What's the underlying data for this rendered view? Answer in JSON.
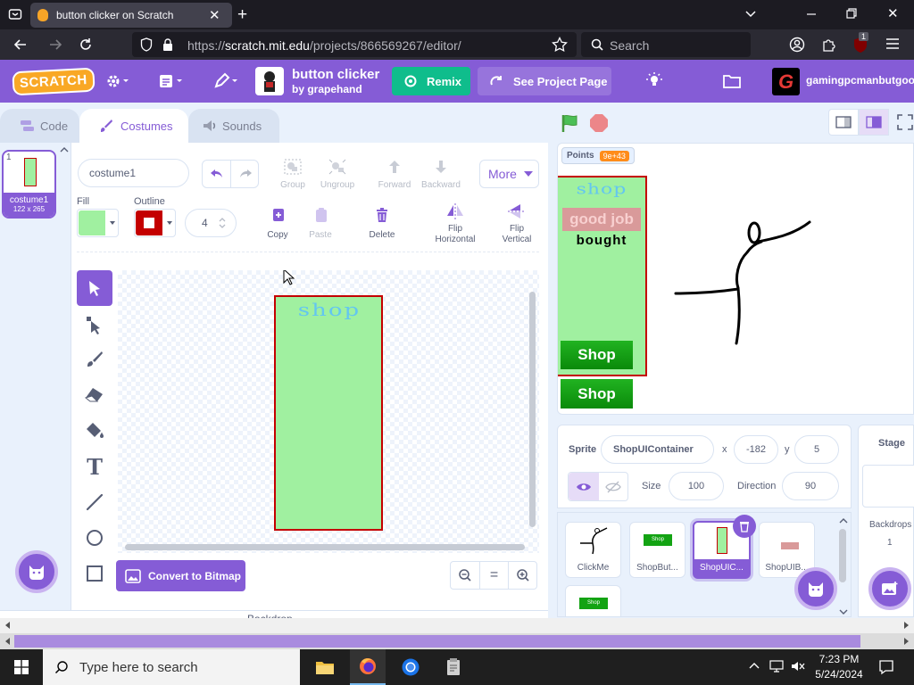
{
  "browser": {
    "tab_title": "button clicker on Scratch",
    "url_prefix": "https://",
    "url_host": "scratch.mit.edu",
    "url_path": "/projects/866569267/editor/",
    "search_label": "Search",
    "ext_badge": "1"
  },
  "menubar": {
    "logo": "SCRATCH",
    "project_title": "button clicker",
    "project_author": "by grapehand",
    "remix_label": "Remix",
    "see_project_label": "See Project Page",
    "username": "gamingpcmanbutgoo"
  },
  "tabs": {
    "code": "Code",
    "costumes": "Costumes",
    "sounds": "Sounds"
  },
  "costume_list": [
    {
      "index": "1",
      "name": "costume1",
      "size": "122 x 265"
    }
  ],
  "paint": {
    "costume_name": "costume1",
    "fill_label": "Fill",
    "outline_label": "Outline",
    "outline_width": "4",
    "group": "Group",
    "ungroup": "Ungroup",
    "forward": "Forward",
    "backward": "Backward",
    "more": "More",
    "copy": "Copy",
    "paste": "Paste",
    "delete": "Delete",
    "flip_h_1": "Flip",
    "flip_h_2": "Horizontal",
    "flip_v_1": "Flip",
    "flip_v_2": "Vertical",
    "canvas_text": "shop",
    "convert_label": "Convert to Bitmap",
    "zoom_reset": "=",
    "fill_color": "#a0f0a0",
    "outline_color": "#c40000"
  },
  "stage": {
    "monitor_label": "Points",
    "monitor_value": "9e+43",
    "shop_text": "shop",
    "good_job": "good job",
    "bought": "bought",
    "shop_btn_1": "Shop",
    "shop_btn_2": "Shop"
  },
  "sprite_info": {
    "sprite_label": "Sprite",
    "sprite_name": "ShopUIContainer",
    "x_label": "x",
    "x_value": "-182",
    "y_label": "y",
    "y_value": "5",
    "size_label": "Size",
    "size_value": "100",
    "direction_label": "Direction",
    "direction_value": "90"
  },
  "sprites": [
    {
      "name": "ClickMe"
    },
    {
      "name": "ShopBut..."
    },
    {
      "name": "ShopUIC..."
    },
    {
      "name": "ShopUIB..."
    },
    {
      "name": ""
    }
  ],
  "stage_panel": {
    "title": "Stage",
    "backdrops_label": "Backdrops",
    "backdrops_count": "1"
  },
  "backdrop_hint": "Backdrop",
  "taskbar": {
    "search_placeholder": "Type here to search",
    "time": "7:23 PM",
    "date": "5/24/2024"
  }
}
